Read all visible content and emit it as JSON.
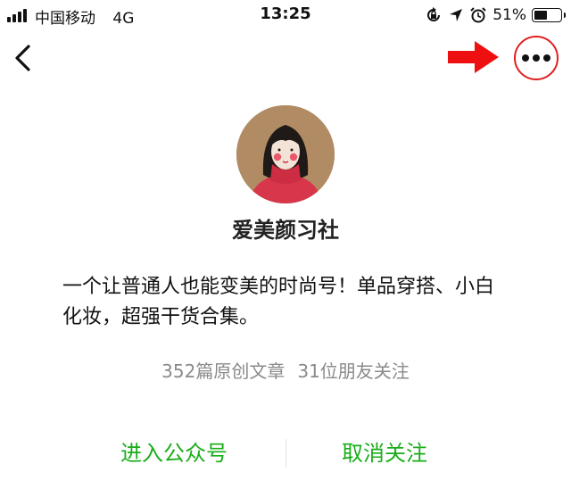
{
  "status_bar": {
    "carrier": "中国移动",
    "network": "4G",
    "time": "13:25",
    "battery_percent": "51%",
    "battery_level": 0.51,
    "icons": [
      "rotation-lock-icon",
      "location-arrow-icon",
      "alarm-icon",
      "battery-icon",
      "signal-bars-icon"
    ]
  },
  "nav": {
    "back_icon": "chevron-left-icon",
    "more_icon": "ellipsis-icon",
    "annotation": {
      "icon": "red-arrow-icon",
      "highlight_color": "#e02020"
    }
  },
  "profile": {
    "name": "爱美颜习社",
    "description": "一个让普通人也能变美的时尚号！单品穿搭、小白化妆，超强干货合集。",
    "stats": {
      "articles": "352篇原创文章",
      "friends": "31位朋友关注"
    }
  },
  "actions": {
    "enter_label": "进入公众号",
    "unfollow_label": "取消关注",
    "accent_color": "#1aad19"
  }
}
